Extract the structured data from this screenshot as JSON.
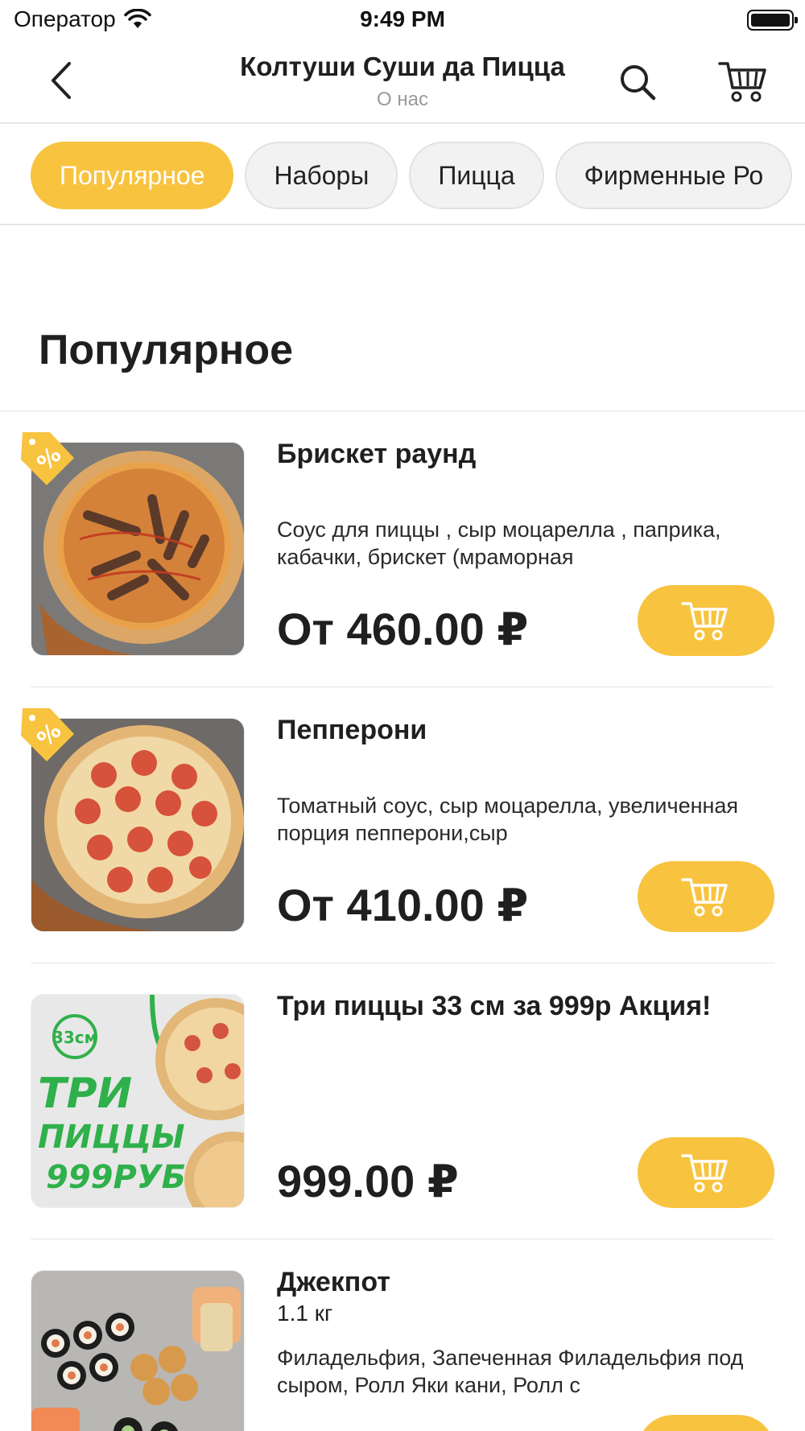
{
  "status_bar": {
    "carrier": "Оператор",
    "time": "9:49 PM"
  },
  "header": {
    "title": "Колтуши Суши да Пицца",
    "subtitle": "О нас"
  },
  "categories": [
    "Популярное",
    "Наборы",
    "Пицца",
    "Фирменные Ро"
  ],
  "active_category": "Популярное",
  "section": {
    "title": "Популярное"
  },
  "products": [
    {
      "name": "Брискет раунд",
      "description": "Соус для пиццы , сыр моцарелла , паприка, кабачки, брискет (мраморная",
      "price": "От 460.00 ₽",
      "discount": true,
      "image": "pizza-brisket"
    },
    {
      "name": "Пепперони",
      "description": "Томатный соус, сыр моцарелла, увеличенная порция пепперони,сыр",
      "price": "От 410.00 ₽",
      "discount": true,
      "image": "pizza-pepperoni"
    },
    {
      "name": "Три пиццы 33 см за 999р Акция!",
      "description": "",
      "price": "999.00 ₽",
      "discount": false,
      "image": "promo-three-pizzas",
      "image_text": {
        "size": "33см",
        "line1": "ТРИ",
        "line2": "ПИЦЦЫ",
        "line3": "999РУБ"
      }
    },
    {
      "name": "Джекпот",
      "weight": "1.1 кг",
      "description": "Филадельфия, Запеченная Филадельфия под сыром, Ролл Яки кани, Ролл с",
      "price": "",
      "discount": false,
      "image": "sushi-set"
    }
  ],
  "colors": {
    "accent": "#f8c33f",
    "text": "#1f1f1f",
    "muted": "#9a9a9a"
  }
}
